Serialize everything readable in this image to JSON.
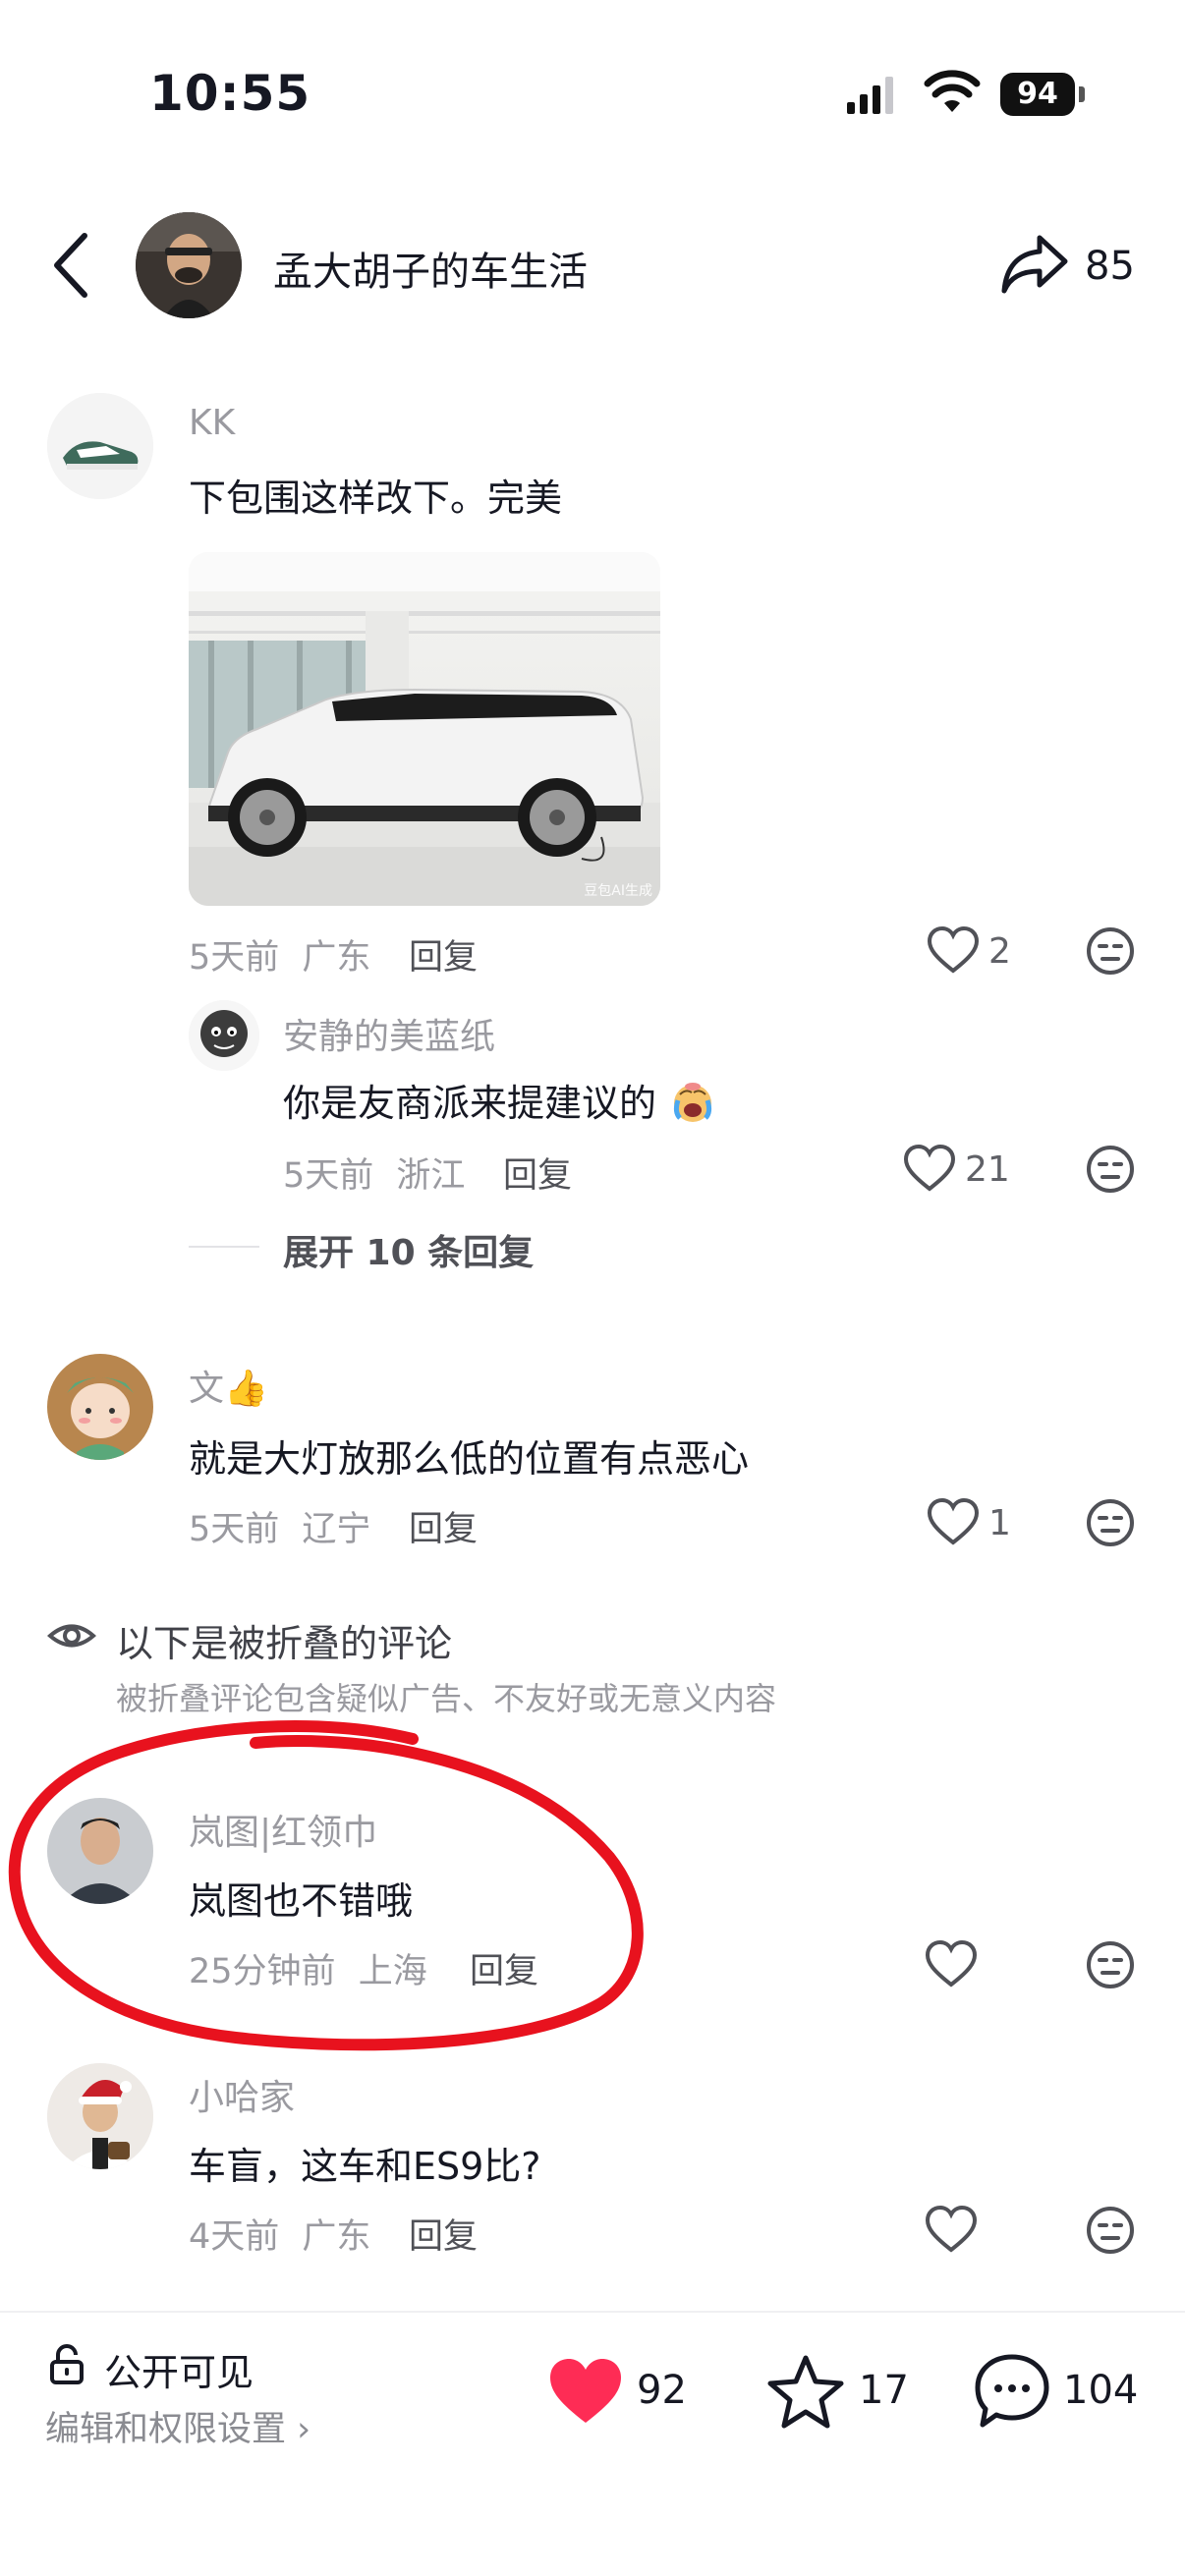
{
  "status_bar": {
    "time": "10:55",
    "battery": "94"
  },
  "header": {
    "title": "孟大胡子的车生活",
    "share_count": "85"
  },
  "comments": [
    {
      "username": "KK",
      "content": "下包围这样改下。完美",
      "time": "5天前",
      "location": "广东",
      "reply": "回复",
      "likes": "2",
      "photo_watermark": "豆包AI生成"
    },
    {
      "username": "安静的美蓝纸",
      "content": "你是友商派来提建议的",
      "time": "5天前",
      "location": "浙江",
      "reply": "回复",
      "likes": "21"
    },
    {
      "username": "文👍",
      "content": "就是大灯放那么低的位置有点恶心",
      "time": "5天前",
      "location": "辽宁",
      "reply": "回复",
      "likes": "1"
    },
    {
      "username": "岚图|红领巾",
      "content": "岚图也不错哦",
      "time": "25分钟前",
      "location": "上海",
      "reply": "回复",
      "likes": ""
    },
    {
      "username": "小哈家",
      "content": "车盲，这车和ES9比?",
      "time": "4天前",
      "location": "广东",
      "reply": "回复",
      "likes": ""
    }
  ],
  "expand_replies": "展开 10 条回复",
  "folded": {
    "title": "以下是被折叠的评论",
    "description": "被折叠评论包含疑似广告、不友好或无意义内容"
  },
  "bottom_bar": {
    "visibility": "公开可见",
    "permissions_link": "编辑和权限设置 ›",
    "likes": "92",
    "favorites": "17",
    "comments": "104"
  },
  "colors": {
    "accent_red": "#fe2c55",
    "annotation_red": "#e8121e",
    "text_primary": "#161823",
    "text_secondary": "#9a9aa0"
  }
}
